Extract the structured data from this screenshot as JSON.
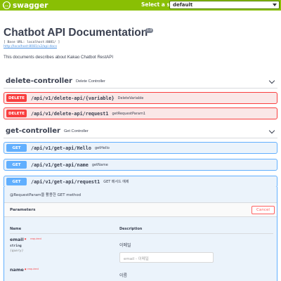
{
  "topbar": {
    "logo_text": "swagger",
    "logo_glyph": "{..}",
    "spec_label": "Select a spec",
    "spec_value": "default"
  },
  "info": {
    "title": "Chatbot API Documentation",
    "version": "1.0",
    "base_url": "[ Base URL: localhost:8081/ ]",
    "doc_link": "http://localhost:8081/v2/api-docs",
    "description": "This documents describes about Kakao Chatbot RestAPI"
  },
  "tags": [
    {
      "name": "delete-controller",
      "description": "Delete Controller"
    },
    {
      "name": "get-controller",
      "description": "Get Controller"
    }
  ],
  "operations": [
    {
      "method": "DELETE",
      "path": "/api/v1/delete-api/{variable}",
      "summary": "DeleteVariable"
    },
    {
      "method": "DELETE",
      "path": "/api/v1/delete-api/request1",
      "summary": "getRequestParam1"
    },
    {
      "method": "GET",
      "path": "/api/v1/get-api/Hello",
      "summary": "getHello"
    },
    {
      "method": "GET",
      "path": "/api/v1/get-api/name",
      "summary": "getName"
    },
    {
      "method": "GET",
      "path": "/api/v1/get-api/request1",
      "summary": "GET 메서드 예제"
    }
  ],
  "expanded": {
    "description": "@RequestParam을 활용한 GET method",
    "parameters_title": "Parameters",
    "cancel_label": "Cancel",
    "col_name": "Name",
    "col_description": "Description",
    "params": [
      {
        "name": "email",
        "required_mark": "*",
        "required_label": "required",
        "type": "string",
        "in": "(query)",
        "description": "이메일",
        "placeholder": "email - 이메일"
      },
      {
        "name": "name",
        "required_mark": "*",
        "required_label": "required",
        "type": "",
        "in": "",
        "description": "이름",
        "placeholder": ""
      }
    ]
  },
  "colors": {
    "topbar": "#89bf04",
    "delete": "#f93e3e",
    "get": "#61affe"
  }
}
